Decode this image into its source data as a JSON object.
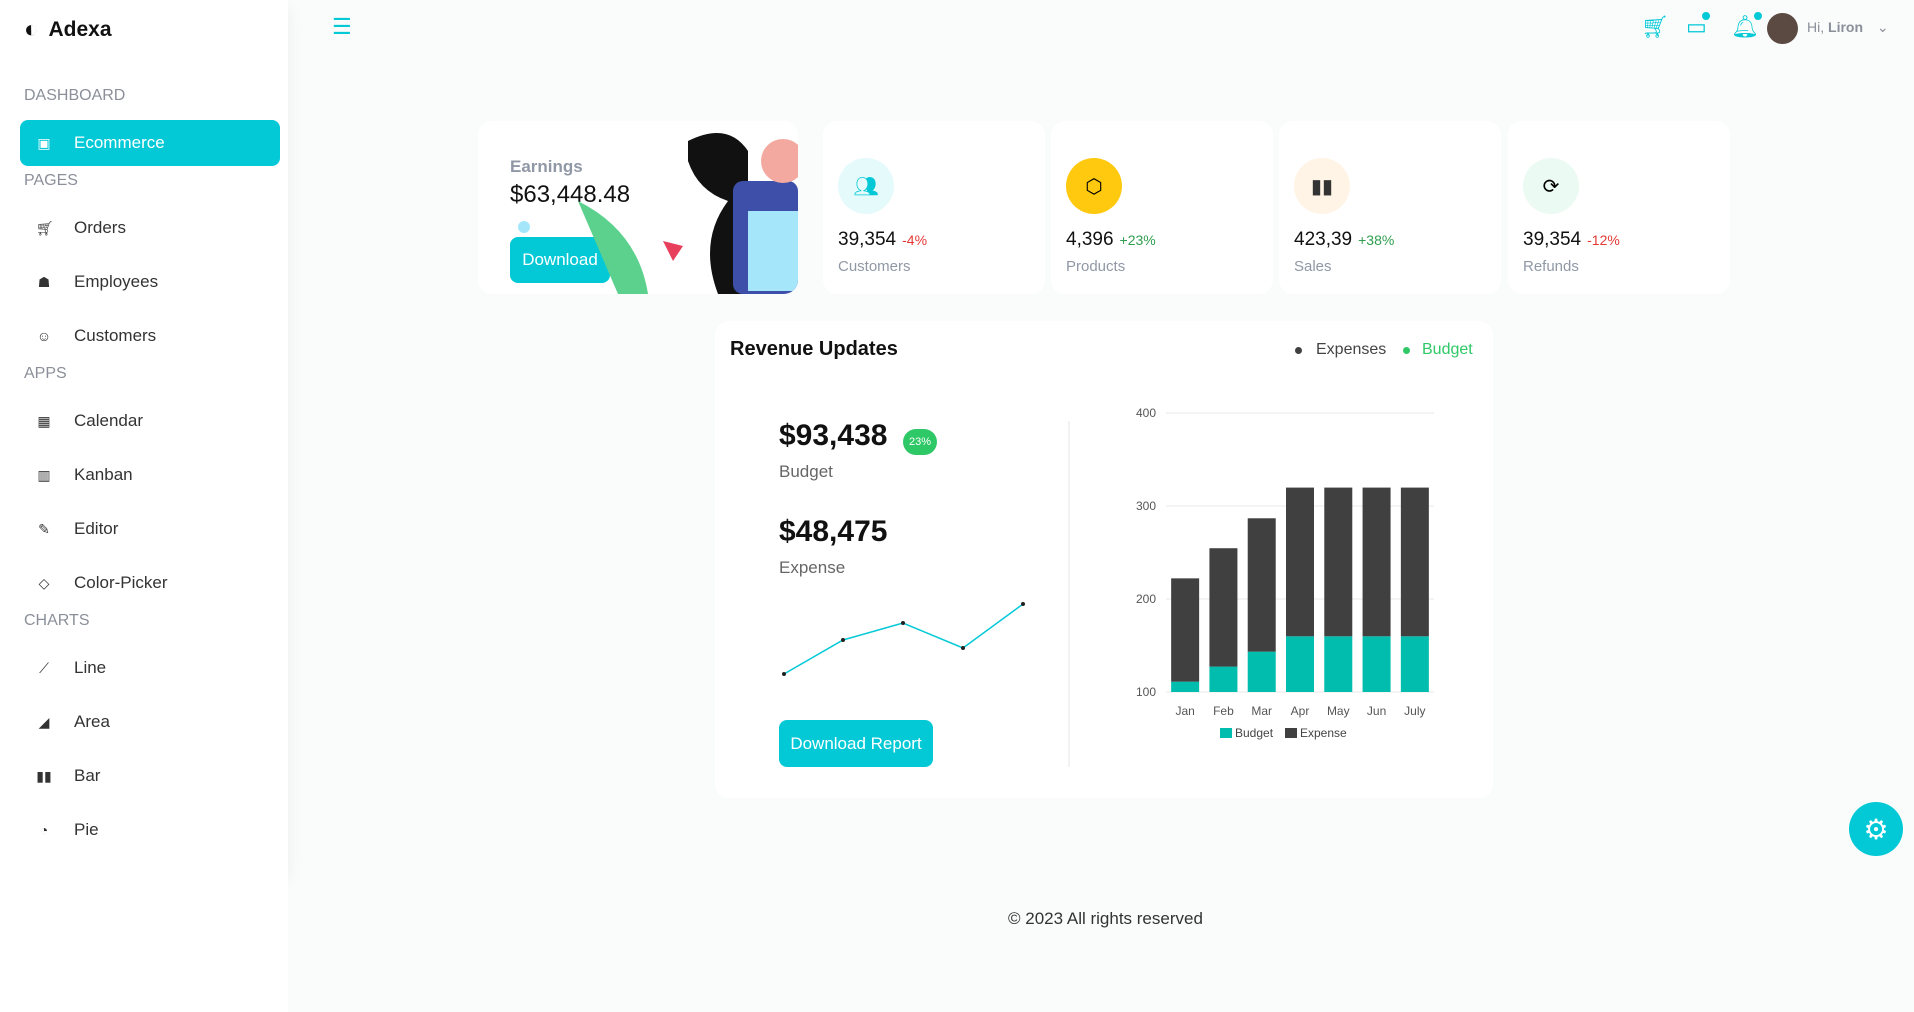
{
  "app": {
    "name": "Adexa"
  },
  "sidebar": {
    "sections": [
      {
        "title": "DASHBOARD",
        "items": [
          {
            "label": "Ecommerce",
            "icon": "shopping-bag-icon",
            "active": true
          }
        ]
      },
      {
        "title": "PAGES",
        "items": [
          {
            "label": "Orders",
            "icon": "cart-icon"
          },
          {
            "label": "Employees",
            "icon": "employees-icon"
          },
          {
            "label": "Customers",
            "icon": "customers-icon"
          }
        ]
      },
      {
        "title": "APPS",
        "items": [
          {
            "label": "Calendar",
            "icon": "calendar-icon"
          },
          {
            "label": "Kanban",
            "icon": "kanban-icon"
          },
          {
            "label": "Editor",
            "icon": "edit-icon"
          },
          {
            "label": "Color-Picker",
            "icon": "color-picker-icon"
          }
        ]
      },
      {
        "title": "CHARTS",
        "items": [
          {
            "label": "Line",
            "icon": "line-chart-icon"
          },
          {
            "label": "Area",
            "icon": "area-chart-icon"
          },
          {
            "label": "Bar",
            "icon": "bar-chart-icon"
          },
          {
            "label": "Pie",
            "icon": "pie-chart-icon"
          }
        ]
      }
    ]
  },
  "header": {
    "greeting": "Hi,",
    "user": "Liron"
  },
  "earnings": {
    "label": "Earnings",
    "value": "$63,448.48",
    "button": "Download"
  },
  "stats": [
    {
      "value": "39,354",
      "change": "-4%",
      "label": "Customers",
      "icon": "users-icon",
      "iconBg": "#e5fafb",
      "iconColor": "#03c9d7",
      "changeColor": "#e53935"
    },
    {
      "value": "4,396",
      "change": "+23%",
      "label": "Products",
      "icon": "box-icon",
      "iconBg": "#fec90f",
      "iconColor": "#000",
      "changeColor": "#2e9e4f"
    },
    {
      "value": "423,39",
      "change": "+38%",
      "label": "Sales",
      "icon": "bar-chart-icon",
      "iconBg": "#fff4e5",
      "iconColor": "#333",
      "changeColor": "#2e9e4f"
    },
    {
      "value": "39,354",
      "change": "-12%",
      "label": "Refunds",
      "icon": "refresh-icon",
      "iconBg": "#ebfaf2",
      "iconColor": "#000",
      "changeColor": "#e53935"
    }
  ],
  "revenue": {
    "title": "Revenue Updates",
    "legend": [
      "Expenses",
      "Budget"
    ],
    "budget": "$93,438",
    "budgetBadge": "23%",
    "budgetLabel": "Budget",
    "expense": "$48,475",
    "expenseLabel": "Expense",
    "button": "Download Report"
  },
  "chart_data": {
    "type": "bar",
    "stacked": true,
    "categories": [
      "Jan",
      "Feb",
      "Mar",
      "Apr",
      "May",
      "Jun",
      "July"
    ],
    "ylim": [
      100,
      400
    ],
    "yticks": [
      100,
      200,
      300,
      400
    ],
    "grid": true,
    "legend": "bottom",
    "series": [
      {
        "name": "Budget",
        "color": "#00bdae",
        "values": [
          111.1,
          127.3,
          143.4,
          159.9,
          159.9,
          159.9,
          159.9
        ]
      },
      {
        "name": "Expense",
        "color": "#404041",
        "values": [
          111.1,
          127.3,
          143.4,
          159.9,
          159.9,
          159.9,
          159.9
        ]
      }
    ]
  },
  "footer": {
    "text": "© 2023 All rights reserved"
  }
}
